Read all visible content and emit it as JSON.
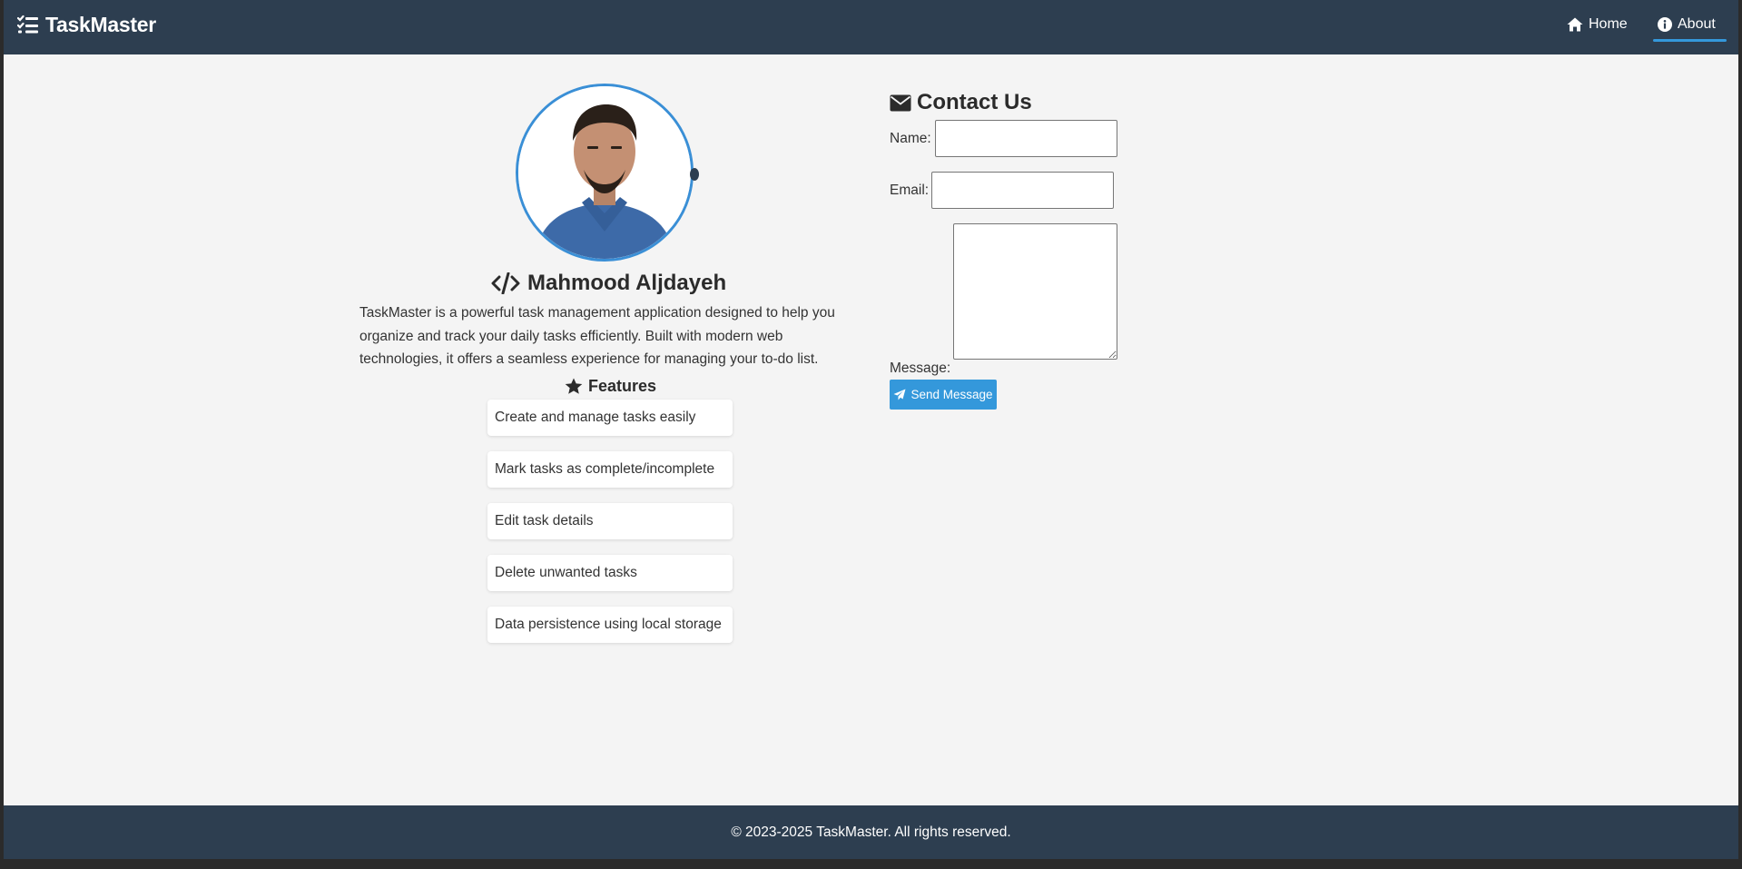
{
  "colors": {
    "nav_background": "#2d3e50",
    "page_background": "#f4f4f4",
    "accent": "#3498db",
    "text_dark": "#2b2b2b"
  },
  "navbar": {
    "brand": "TaskMaster",
    "brand_icon": "list-check-icon",
    "links": [
      {
        "label": "Home",
        "icon": "home-icon",
        "active": false
      },
      {
        "label": "About",
        "icon": "info-circle-icon",
        "active": true
      }
    ]
  },
  "profile": {
    "name": "Mahmood Aljdayeh",
    "name_icon": "code-icon",
    "description": "TaskMaster is a powerful task management application designed to help you organize and track your daily tasks efficiently. Built with modern web technologies, it offers a seamless experience for managing your to-do list."
  },
  "features": {
    "title": "Features",
    "icon": "star-icon",
    "items": [
      "Create and manage tasks easily",
      "Mark tasks as complete/incomplete",
      "Edit task details",
      "Delete unwanted tasks",
      "Data persistence using local storage"
    ]
  },
  "contact": {
    "title": "Contact Us",
    "icon": "envelope-icon",
    "name_label": "Name:",
    "name_value": "",
    "email_label": "Email:",
    "email_value": "",
    "message_label": "Message:",
    "message_value": "",
    "send_label": "Send Message",
    "send_icon": "paper-plane-icon"
  },
  "footer": {
    "text": "© 2023-2025 TaskMaster. All rights reserved."
  }
}
